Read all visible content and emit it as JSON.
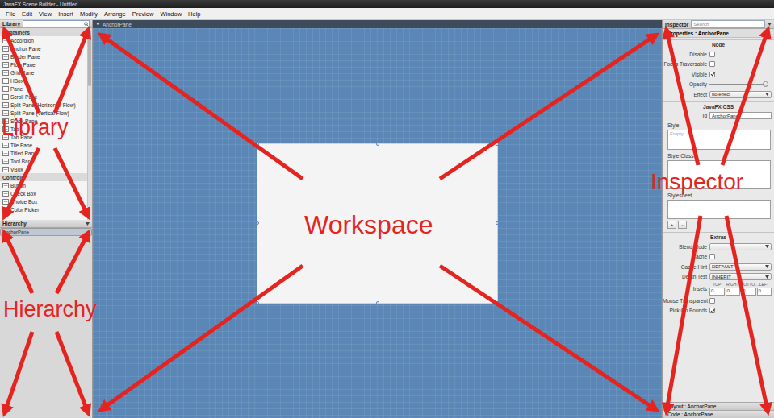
{
  "window": {
    "title": "JavaFX Scene Builder - Untitled"
  },
  "menu": [
    "File",
    "Edit",
    "View",
    "Insert",
    "Modify",
    "Arrange",
    "Preview",
    "Window",
    "Help"
  ],
  "library": {
    "title": "Library",
    "items": [
      {
        "label": "Containers",
        "kind": "section"
      },
      {
        "label": "Accordion",
        "kind": "item"
      },
      {
        "label": "Anchor Pane",
        "kind": "item"
      },
      {
        "label": "Border Pane",
        "kind": "item"
      },
      {
        "label": "Flow Pane",
        "kind": "item"
      },
      {
        "label": "Grid Pane",
        "kind": "item"
      },
      {
        "label": "HBox",
        "kind": "item"
      },
      {
        "label": "Pane",
        "kind": "item"
      },
      {
        "label": "Scroll Pane",
        "kind": "item"
      },
      {
        "label": "Split Pane (Horizontal Flow)",
        "kind": "item"
      },
      {
        "label": "Split Pane (Vertical Flow)",
        "kind": "item"
      },
      {
        "label": "Stack Pane",
        "kind": "item"
      },
      {
        "label": "Tab",
        "kind": "item"
      },
      {
        "label": "Tab Pane",
        "kind": "item"
      },
      {
        "label": "Tile Pane",
        "kind": "item"
      },
      {
        "label": "Titled Pane",
        "kind": "item"
      },
      {
        "label": "Tool Bar",
        "kind": "item"
      },
      {
        "label": "VBox",
        "kind": "item"
      },
      {
        "label": "Controls",
        "kind": "section"
      },
      {
        "label": "Button",
        "kind": "item"
      },
      {
        "label": "Check Box",
        "kind": "item"
      },
      {
        "label": "Choice Box",
        "kind": "item"
      },
      {
        "label": "Color Picker",
        "kind": "item"
      }
    ]
  },
  "hierarchy": {
    "title": "Hierarchy",
    "items": [
      {
        "label": "AnchorPane",
        "selected": true
      }
    ]
  },
  "workspace": {
    "path": "AnchorPane"
  },
  "inspector": {
    "title": "Inspector",
    "search": {
      "placeholder": "Search"
    },
    "properties": "Properties : AnchorPane",
    "sections": [
      {
        "title": "Node",
        "rows": [
          {
            "kind": "checkbox",
            "label": "Disable",
            "checked": false
          },
          {
            "kind": "checkbox",
            "label": "Focus Traversable",
            "checked": false
          },
          {
            "kind": "checkbox",
            "label": "Visible",
            "checked": true
          },
          {
            "kind": "slider",
            "label": "Opacity",
            "level": 0.95
          },
          {
            "kind": "select",
            "label": "Effect",
            "value": "no effect"
          }
        ]
      },
      {
        "title": "JavaFX CSS",
        "rows": [
          {
            "kind": "text",
            "label": "Id",
            "value": "AnchorPane"
          },
          {
            "kind": "textarea",
            "label": "Style",
            "value": "Empty"
          },
          {
            "kind": "list",
            "label": "Style Class"
          },
          {
            "kind": "list",
            "label": "Stylesheet",
            "buttons": [
              "+",
              "-"
            ]
          }
        ]
      },
      {
        "title": "Extras",
        "rows": [
          {
            "kind": "select",
            "label": "Blend Mode"
          },
          {
            "kind": "checkbox",
            "label": "Cache",
            "checked": false
          },
          {
            "kind": "select",
            "label": "Cache Hint",
            "value": "DEFAULT"
          },
          {
            "kind": "select",
            "label": "Depth Test",
            "value": "INHERIT"
          },
          {
            "kind": "insets",
            "label": "Insets",
            "columns": [
              "TOP",
              "RIGHT",
              "BOTTO…",
              "LEFT"
            ],
            "values": [
              "0",
              "0",
              "0",
              "0"
            ]
          },
          {
            "kind": "checkbox",
            "label": "Mouse Transparent",
            "checked": false
          },
          {
            "kind": "checkbox",
            "label": "Pick On Bounds",
            "checked": true
          }
        ]
      }
    ]
  },
  "footer": [
    "Layout : AnchorPane",
    "Code : AnchorPane"
  ],
  "annotations": [
    {
      "label": "Library"
    },
    {
      "label": "Hierarchy"
    },
    {
      "label": "Workspace"
    },
    {
      "label": "Inspector"
    }
  ]
}
